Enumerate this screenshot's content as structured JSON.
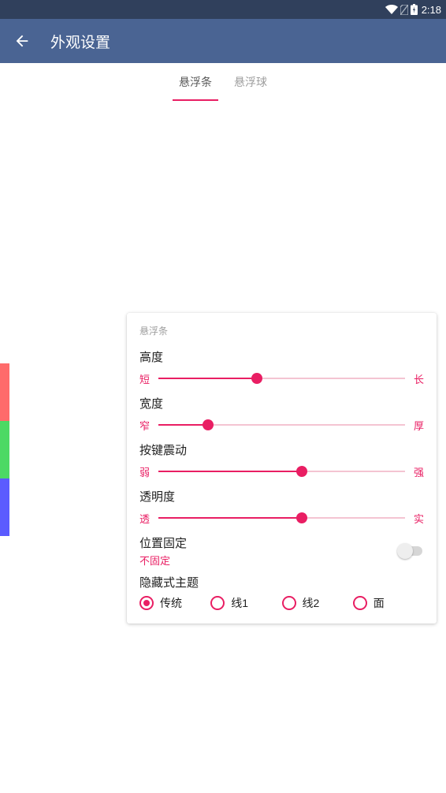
{
  "statusbar": {
    "time": "2:18"
  },
  "appbar": {
    "title": "外观设置"
  },
  "tabs": {
    "items": [
      {
        "label": "悬浮条",
        "active": true
      },
      {
        "label": "悬浮球",
        "active": false
      }
    ]
  },
  "card": {
    "section": "悬浮条",
    "height": {
      "title": "高度",
      "min": "短",
      "max": "长",
      "value": 40
    },
    "width": {
      "title": "宽度",
      "min": "窄",
      "max": "厚",
      "value": 20
    },
    "vibration": {
      "title": "按键震动",
      "min": "弱",
      "max": "强",
      "value": 58
    },
    "opacity": {
      "title": "透明度",
      "min": "透",
      "max": "实",
      "value": 58
    },
    "lock": {
      "title": "位置固定",
      "sub": "不固定",
      "on": false
    },
    "theme": {
      "title": "隐藏式主题",
      "options": [
        "传统",
        "线1",
        "线2",
        "面"
      ],
      "selected": 0
    }
  },
  "chart_data": null
}
